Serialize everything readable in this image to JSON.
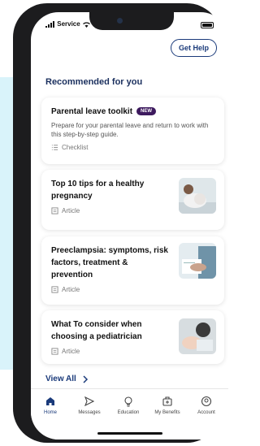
{
  "status": {
    "carrier": "Service"
  },
  "header": {
    "help_label": "Get Help"
  },
  "section": {
    "title": "Recommended for you"
  },
  "cards": [
    {
      "title": "Parental leave toolkit",
      "badge": "NEW",
      "description": "Prepare for your parental leave and return to work with this step-by-step guide.",
      "type": "Checklist"
    },
    {
      "title": "Top 10 tips for a healthy pregnancy",
      "type": "Article"
    },
    {
      "title": "Preeclampsia: symptoms, risk factors, treatment & prevention",
      "type": "Article"
    },
    {
      "title": "What To consider when choosing a pediatrician",
      "type": "Article"
    }
  ],
  "view_all": "View All",
  "tabs": [
    {
      "label": "Home",
      "icon": "home-icon",
      "active": true
    },
    {
      "label": "Messages",
      "icon": "send-icon",
      "active": false
    },
    {
      "label": "Education",
      "icon": "lightbulb-icon",
      "active": false
    },
    {
      "label": "My Benefits",
      "icon": "benefits-bag-icon",
      "active": false
    },
    {
      "label": "Account",
      "icon": "account-icon",
      "active": false
    }
  ],
  "colors": {
    "accent": "#1a3a7a",
    "badge": "#3d1a5e",
    "background_shape": "#d9f3fa"
  }
}
